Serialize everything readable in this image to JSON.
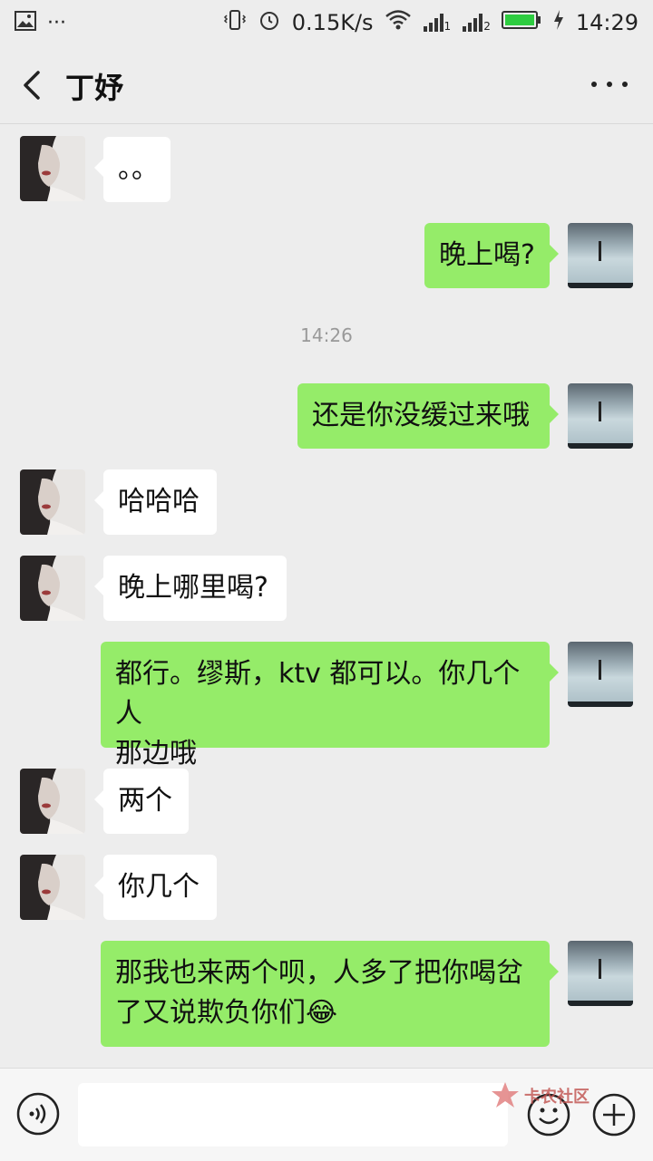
{
  "status_bar": {
    "dots": "···",
    "speed": "0.15K/s",
    "sim1": "1",
    "sim2": "2",
    "time": "14:29"
  },
  "header": {
    "title": "丁妤"
  },
  "messages": [
    {
      "side": "in",
      "text": "。。"
    },
    {
      "side": "out",
      "text": "晚上喝?"
    },
    {
      "side": "out",
      "text": "还是你没缓过来哦"
    },
    {
      "side": "in",
      "text": "哈哈哈"
    },
    {
      "side": "in",
      "text": "晚上哪里喝?"
    },
    {
      "side": "out",
      "line1": "都行。缪斯，ktv 都可以。你几个人",
      "line2": "那边哦"
    },
    {
      "side": "in",
      "text": "两个"
    },
    {
      "side": "in",
      "text": "你几个"
    },
    {
      "side": "out",
      "line1": "那我也来两个呗，人多了把你喝岔",
      "line2": "了又说欺负你们😂"
    }
  ],
  "timestamp": "14:26",
  "input": {
    "placeholder": ""
  },
  "watermark": "卡农社区",
  "colors": {
    "outgoing": "#95ec69",
    "incoming": "#ffffff",
    "background": "#ededed"
  }
}
